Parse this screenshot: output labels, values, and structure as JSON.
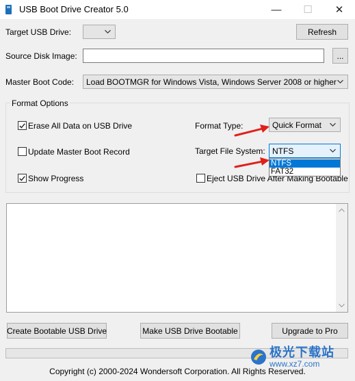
{
  "window": {
    "title": "USB Boot Drive Creator 5.0",
    "minimize_glyph": "—",
    "maximize_glyph": "☐",
    "close_glyph": "✕"
  },
  "target_usb": {
    "label": "Target USB Drive:",
    "value": ""
  },
  "refresh_button": "Refresh",
  "source_image": {
    "label": "Source Disk Image:",
    "value": "",
    "browse_label": "..."
  },
  "master_boot": {
    "label": "Master Boot Code:",
    "value": "Load BOOTMGR for Windows Vista, Windows Server 2008 or higher"
  },
  "format_options": {
    "legend": "Format Options",
    "erase_all": {
      "label": "Erase All Data on USB Drive",
      "checked": true
    },
    "update_mbr": {
      "label": "Update Master Boot Record",
      "checked": false
    },
    "show_progress": {
      "label": "Show Progress",
      "checked": true
    },
    "eject_usb": {
      "label": "Eject USB Drive After Making Bootable",
      "checked": false
    },
    "format_type": {
      "label": "Format Type:",
      "value": "Quick Format"
    },
    "file_system": {
      "label": "Target File System:",
      "value": "NTFS",
      "options": [
        "NTFS",
        "FAT32"
      ]
    }
  },
  "log_text": "",
  "buttons": {
    "create": "Create Bootable USB Drive",
    "make": "Make USB Drive Bootable",
    "upgrade": "Upgrade to Pro"
  },
  "progress": 0,
  "footer": "Copyright (c) 2000-2024 Wondersoft Corporation. All Rights Reserved.",
  "watermark": {
    "text": "极光下载站",
    "url": "www.xz7.com"
  },
  "colors": {
    "accent": "#0078d7",
    "annotation_arrow": "#e0201b"
  },
  "icons": {
    "app": "usb-drive-icon",
    "dropdown": "chevron-down-icon",
    "checkmark": "checkmark-icon",
    "scroll_up": "scroll-up-arrow-icon",
    "scroll_down": "scroll-down-arrow-icon"
  }
}
